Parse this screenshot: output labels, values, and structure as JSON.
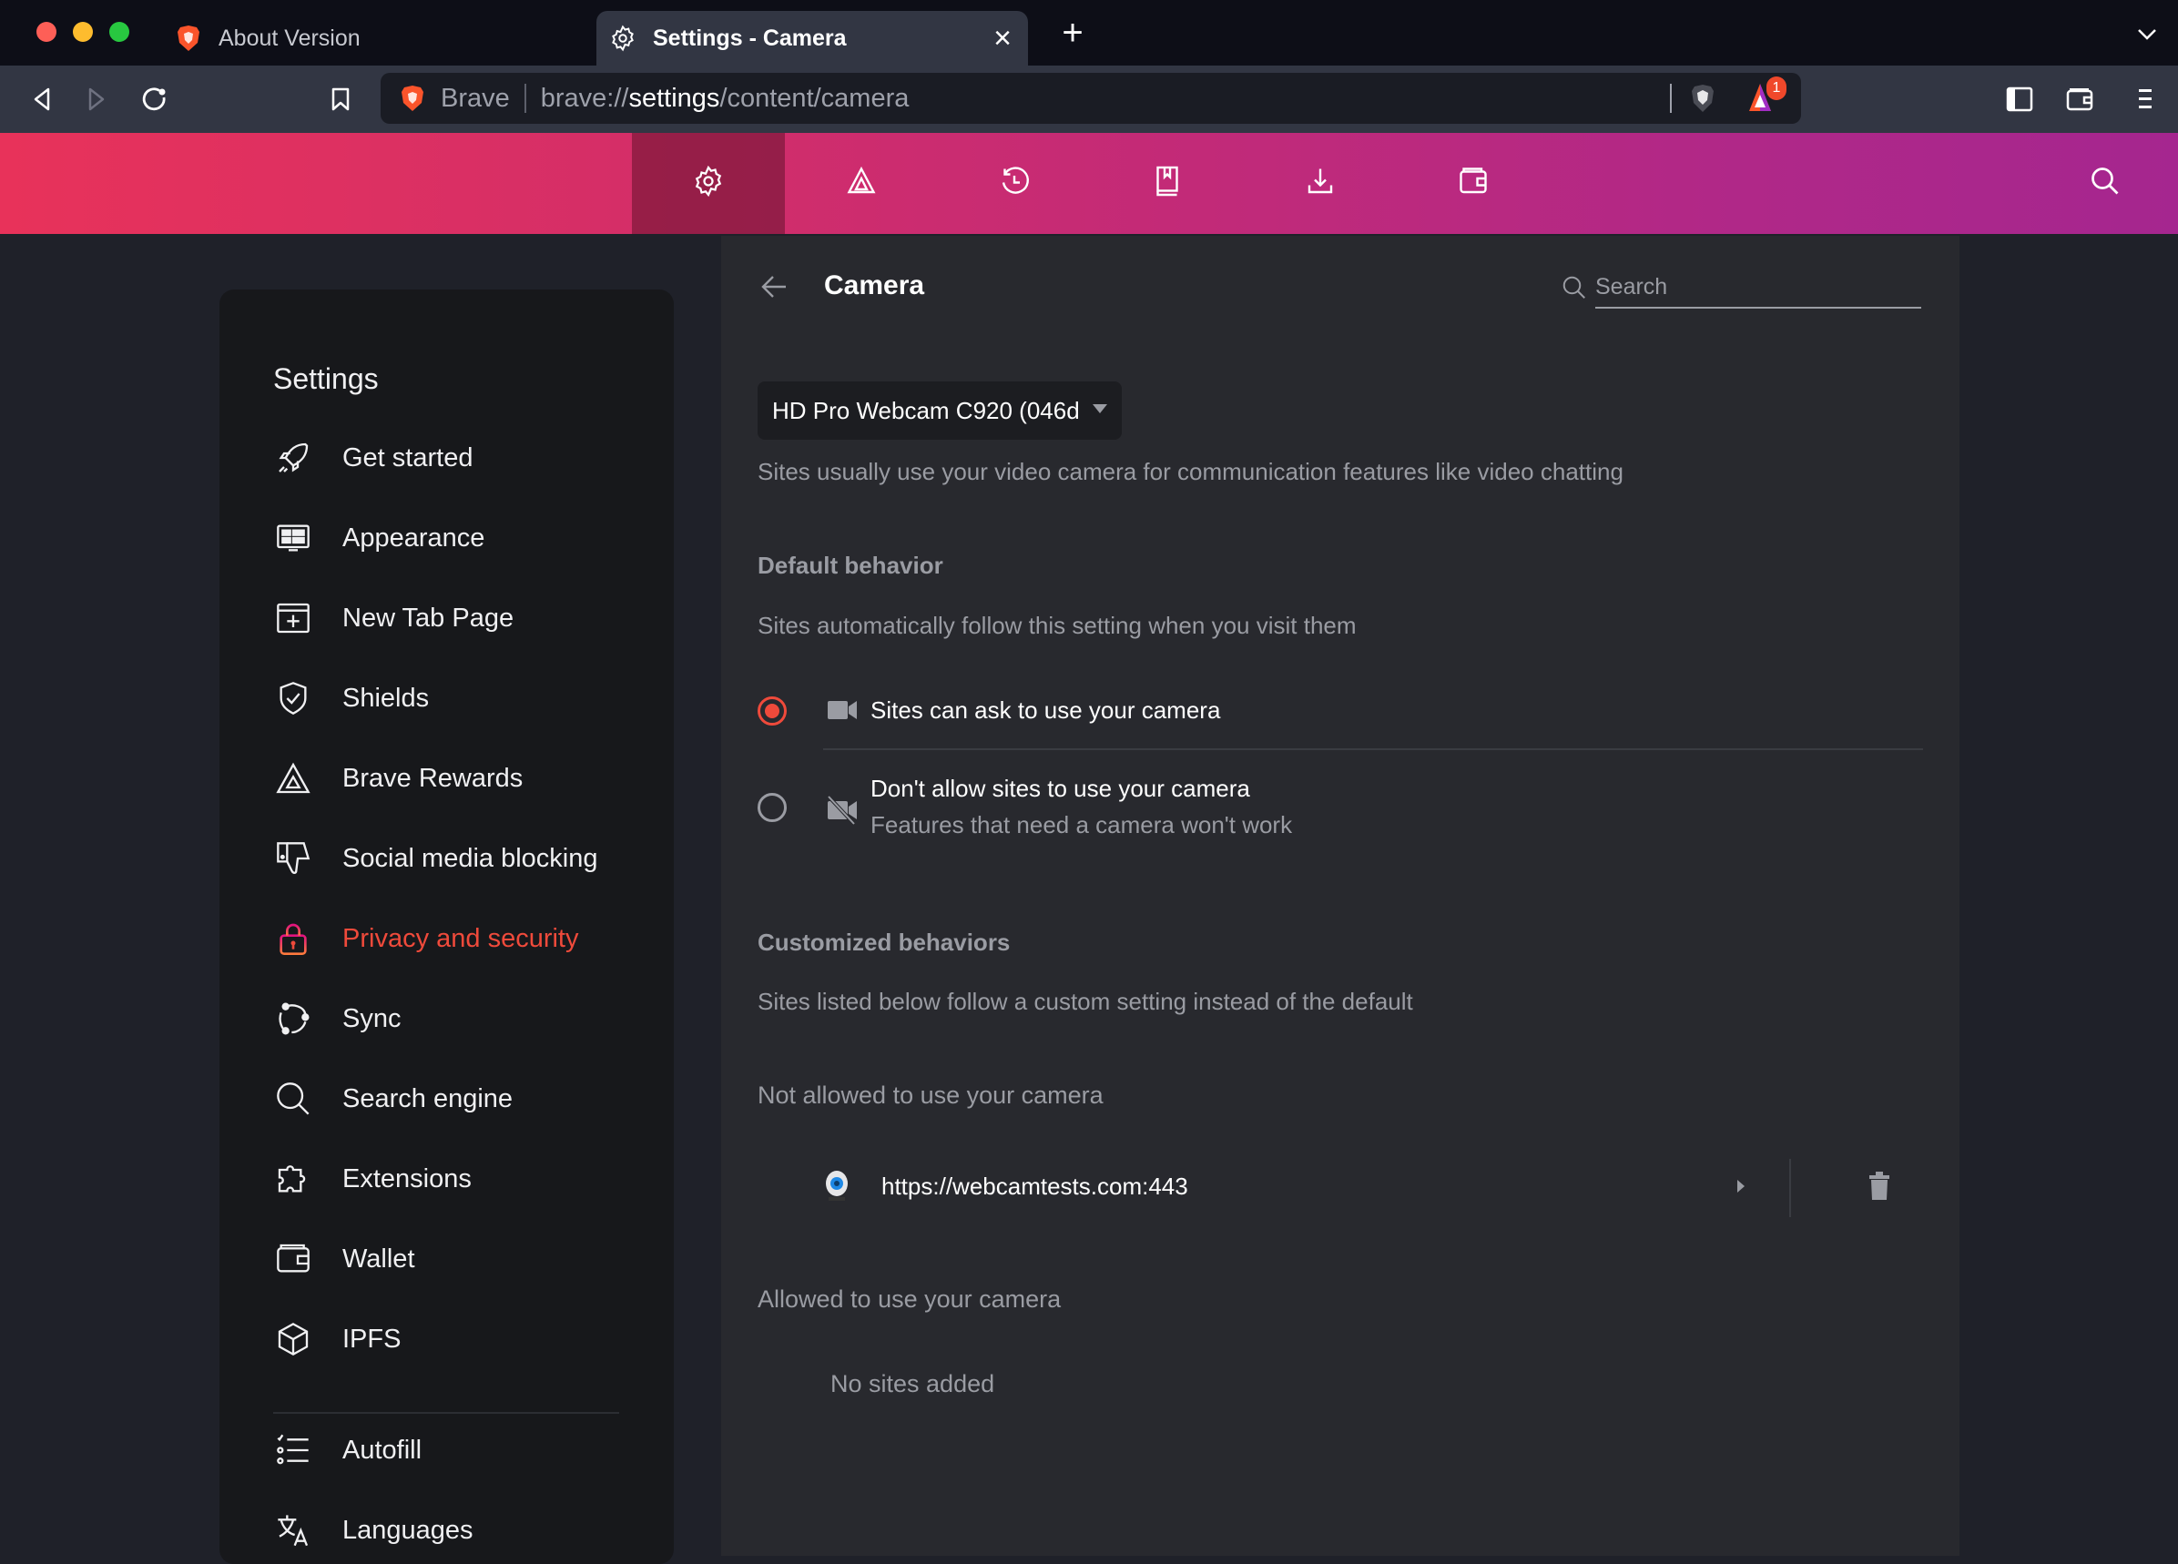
{
  "window": {
    "traffic_lights": {
      "close": "#fe5f57",
      "minimize": "#febc2e",
      "maximize": "#28c840"
    }
  },
  "tabs": [
    {
      "label": "About Version",
      "icon": "brave-lion-icon",
      "active": false
    },
    {
      "label": "Settings - Camera",
      "icon": "gear-icon",
      "active": true,
      "close_label": "×"
    }
  ],
  "new_tab_label": "+",
  "tab_menu_icon": "chevron-down-icon",
  "toolbar": {
    "back": "back-icon",
    "forward": "forward-icon",
    "reload": "reload-icon",
    "bookmark": "bookmark-icon",
    "site_label": "Brave",
    "url_prefix": "brave://",
    "url_host": "settings",
    "url_path": "/content/camera",
    "rewards_badge": "1",
    "right_icons": [
      "sidebar-icon",
      "wallet-icon",
      "menu-icon"
    ]
  },
  "nav_bar": {
    "icons": [
      "gear-icon",
      "rewards-icon",
      "history-icon",
      "bookmarks-icon",
      "downloads-icon",
      "wallet-icon"
    ],
    "active_index": 0,
    "search_icon": "search-icon"
  },
  "sidebar": {
    "title": "Settings",
    "items": [
      {
        "label": "Get started",
        "icon": "rocket-icon"
      },
      {
        "label": "Appearance",
        "icon": "appearance-icon"
      },
      {
        "label": "New Tab Page",
        "icon": "new-tab-icon"
      },
      {
        "label": "Shields",
        "icon": "shield-icon"
      },
      {
        "label": "Brave Rewards",
        "icon": "rewards-icon"
      },
      {
        "label": "Social media blocking",
        "icon": "thumbs-down-icon"
      },
      {
        "label": "Privacy and security",
        "icon": "lock-icon",
        "active": true
      },
      {
        "label": "Sync",
        "icon": "sync-icon"
      },
      {
        "label": "Search engine",
        "icon": "search-icon"
      },
      {
        "label": "Extensions",
        "icon": "puzzle-icon"
      },
      {
        "label": "Wallet",
        "icon": "wallet-icon"
      },
      {
        "label": "IPFS",
        "icon": "cube-icon"
      }
    ],
    "items_after_divider": [
      {
        "label": "Autofill",
        "icon": "checklist-icon"
      },
      {
        "label": "Languages",
        "icon": "translate-icon"
      }
    ],
    "accent": "#ef4a3b"
  },
  "main": {
    "title": "Camera",
    "search_placeholder": "Search",
    "camera_select": "HD Pro Webcam C920 (046d",
    "description": "Sites usually use your video camera for communication features like video chatting",
    "default_behavior": {
      "heading": "Default behavior",
      "subtitle": "Sites automatically follow this setting when you visit them",
      "options": [
        {
          "label": "Sites can ask to use your camera",
          "sublabel": "",
          "icon": "camera-icon",
          "selected": true
        },
        {
          "label": "Don't allow sites to use your camera",
          "sublabel": "Features that need a camera won't work",
          "icon": "camera-off-icon",
          "selected": false
        }
      ]
    },
    "customized": {
      "heading": "Customized behaviors",
      "subtitle": "Sites listed below follow a custom setting instead of the default",
      "blocked": {
        "heading": "Not allowed to use your camera",
        "sites": [
          {
            "url": "https://webcamtests.com:443"
          }
        ]
      },
      "allowed": {
        "heading": "Allowed to use your camera",
        "empty": "No sites added"
      }
    },
    "radio_color": "#ef4a3b"
  }
}
